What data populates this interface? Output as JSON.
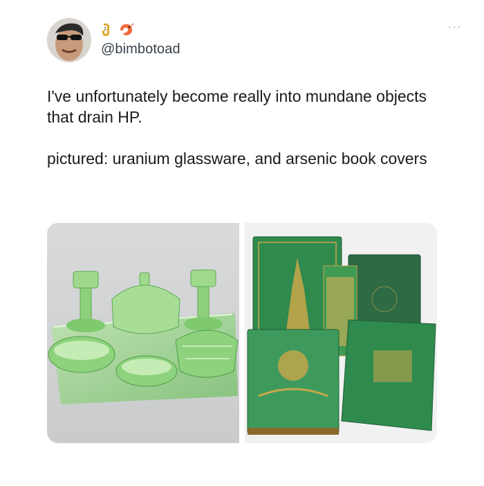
{
  "author": {
    "handle": "@bimbotoad",
    "emoji_badges": [
      "saxophone-emoji",
      "shrimp-emoji"
    ]
  },
  "tweet": {
    "line1": "I've unfortunately become really into mundane objects that drain HP.",
    "line2": "pictured: uranium glassware, and arsenic book covers"
  },
  "media": {
    "images": [
      {
        "subject": "green uranium glass vanity set"
      },
      {
        "subject": "green arsenic cloth book covers with bookmark"
      }
    ]
  },
  "menu": {
    "more_label": "···"
  },
  "colors": {
    "accent_green": "#7bc96f",
    "book_green": "#2f8a4e",
    "gold": "#c9a64a"
  }
}
